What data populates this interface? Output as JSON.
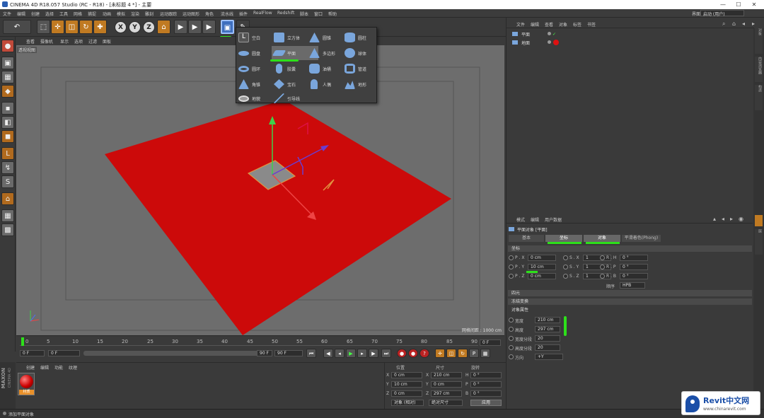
{
  "window": {
    "title": "CINEMA 4D R18.057 Studio (RC - R18) - [未标题 4 *] - 主要",
    "minimize": "—",
    "maximize": "☐",
    "close": "✕"
  },
  "menubar": {
    "items": [
      "文件",
      "编辑",
      "创建",
      "选择",
      "工具",
      "网格",
      "捕捉",
      "动画",
      "模拟",
      "渲染",
      "雕刻",
      "运动跟踪",
      "运动图形",
      "角色",
      "流水线",
      "插件",
      "RealFlow",
      "Redshift",
      "脚本",
      "窗口",
      "帮助"
    ],
    "layout_label": "界面",
    "layout_value": "启动 (用户)"
  },
  "toolbar": {
    "undo": "↶",
    "x": "X",
    "y": "Y",
    "z": "Z"
  },
  "viewport": {
    "menu": [
      "查看",
      "摄像机",
      "显示",
      "选项",
      "过滤",
      "面板"
    ],
    "label": "透视视图",
    "grid_info": "网格间距 : 1000 cm",
    "plane_color": "#cc0a0a"
  },
  "popup": {
    "items": [
      {
        "label": "空白",
        "icon": "null-icon"
      },
      {
        "label": "立方体",
        "icon": "cube-icon"
      },
      {
        "label": "圆锥",
        "icon": "cone-icon"
      },
      {
        "label": "圆柱",
        "icon": "cylinder-icon"
      },
      {
        "label": "圆盘",
        "icon": "disc-icon"
      },
      {
        "label": "平面",
        "icon": "plane-icon"
      },
      {
        "label": "多边形",
        "icon": "polygon-icon"
      },
      {
        "label": "球体",
        "icon": "sphere-icon"
      },
      {
        "label": "圆环",
        "icon": "torus-icon"
      },
      {
        "label": "胶囊",
        "icon": "capsule-icon"
      },
      {
        "label": "油桶",
        "icon": "oiltank-icon"
      },
      {
        "label": "管道",
        "icon": "tube-icon"
      },
      {
        "label": "角锥",
        "icon": "pyramid-icon"
      },
      {
        "label": "宝石",
        "icon": "platonic-icon"
      },
      {
        "label": "人偶",
        "icon": "figure-icon"
      },
      {
        "label": "地形",
        "icon": "landscape-icon"
      },
      {
        "label": "地貌",
        "icon": "relief-icon"
      },
      {
        "label": "引导线",
        "icon": "guide-icon"
      }
    ]
  },
  "timeline": {
    "ticks": [
      "0",
      "5",
      "10",
      "15",
      "20",
      "25",
      "30",
      "35",
      "40",
      "45",
      "50",
      "55",
      "60",
      "65",
      "70",
      "75",
      "80",
      "85",
      "90"
    ],
    "frame_end_label": "0 F",
    "current": "0 F",
    "start": "0 F",
    "end": "90 F",
    "end2": "90 F"
  },
  "object_manager": {
    "menu": [
      "文件",
      "编辑",
      "查看",
      "对象",
      "标签",
      "书签"
    ],
    "objects": [
      {
        "name": "平面"
      },
      {
        "name": "地面"
      }
    ],
    "side_tabs": [
      "对象",
      "内容浏览器",
      "构造",
      "层"
    ]
  },
  "attributes": {
    "menu": [
      "模式",
      "编辑",
      "用户数据"
    ],
    "object_title": "平面对象 [平面]",
    "tabs": [
      "基本",
      "坐标",
      "对象",
      "平滑着色(Phong)"
    ],
    "coord_header": "坐标",
    "coords": [
      {
        "p_label": "P . X",
        "p_val": "0 cm",
        "s_label": "S . X",
        "s_val": "1",
        "r_label": "R . H",
        "r_val": "0 °"
      },
      {
        "p_label": "P . Y",
        "p_val": "10 cm",
        "s_label": "S . Y",
        "s_val": "1",
        "r_label": "R . P",
        "r_val": "0 °"
      },
      {
        "p_label": "P . Z",
        "p_val": "0 cm",
        "s_label": "S . Z",
        "s_val": "1",
        "r_label": "R . B",
        "r_val": "0 °"
      }
    ],
    "order_label": "顺序",
    "order_value": "HPB",
    "section_quat": "四元",
    "section_freeze": "冻结变换",
    "object_header": "对象属性",
    "object_props": [
      {
        "label": "宽度",
        "value": "210 cm"
      },
      {
        "label": "高度",
        "value": "297 cm"
      },
      {
        "label": "宽度分段",
        "value": "20"
      },
      {
        "label": "高度分段",
        "value": "20"
      },
      {
        "label": "方向",
        "value": "+Y"
      }
    ]
  },
  "material_manager": {
    "menu": [
      "创建",
      "编辑",
      "功能",
      "纹理"
    ],
    "material_name": "材质"
  },
  "coordinates": {
    "headers": [
      "位置",
      "尺寸",
      "旋转"
    ],
    "rows": [
      {
        "axis": "X",
        "pos": "0 cm",
        "size_axis": "X",
        "size": "210 cm",
        "rot_axis": "H",
        "rot": "0 °"
      },
      {
        "axis": "Y",
        "pos": "10 cm",
        "size_axis": "Y",
        "size": "0 cm",
        "rot_axis": "P",
        "rot": "0 °"
      },
      {
        "axis": "Z",
        "pos": "0 cm",
        "size_axis": "Z",
        "size": "297 cm",
        "rot_axis": "B",
        "rot": "0 °"
      }
    ],
    "mode1": "对象 (相对)",
    "mode2": "绝对尺寸",
    "apply": "应用"
  },
  "status": {
    "text": "添加平面对象"
  },
  "maxon": {
    "brand": "MAXON",
    "product": "CINEMA 4D"
  },
  "watermark": {
    "brand": "Revit中文网",
    "url": "www.chinarevit.com"
  }
}
